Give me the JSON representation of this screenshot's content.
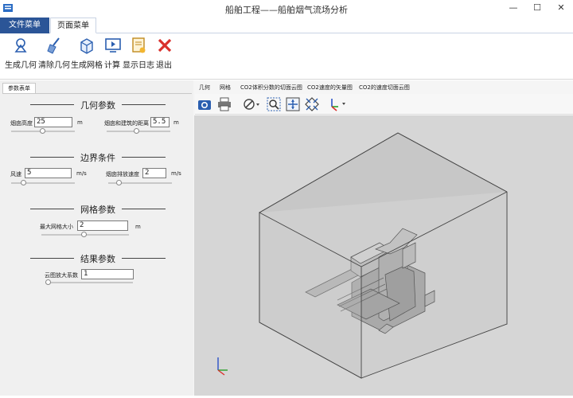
{
  "window": {
    "title": "船舶工程——船舶烟气流场分析",
    "minimize": "—",
    "maximize": "☐",
    "close": "✕"
  },
  "menu_tabs": {
    "file": "文件菜单",
    "page": "页面菜单"
  },
  "ribbon": {
    "gen_geometry": "生成几何",
    "clear_geometry": "清除几何",
    "gen_mesh": "生成网格",
    "compute": "计算",
    "show_log": "显示日志",
    "exit": "退出"
  },
  "params_panel": {
    "tab": "参数表单",
    "geometry": {
      "title": "几何参数",
      "chimney_height_label": "烟囱高度",
      "chimney_height_value": "25",
      "chimney_height_unit": "m",
      "distance_label": "烟囱和建筑的距离",
      "distance_value": "5.5",
      "distance_unit": "m"
    },
    "boundary": {
      "title": "边界条件",
      "wind_label": "风速",
      "wind_value": "5",
      "wind_unit": "m/s",
      "exhaust_label": "烟囱排放速度",
      "exhaust_value": "2",
      "exhaust_unit": "m/s"
    },
    "mesh": {
      "title": "网格参数",
      "max_size_label": "最大网格大小",
      "max_size_value": "2",
      "max_size_unit": "m"
    },
    "result": {
      "title": "结果参数",
      "scale_label": "云图放大系数",
      "scale_value": "1"
    }
  },
  "view_tabs": [
    "几何",
    "网格",
    "CO2体积分数的切面云图",
    "CO2速度的矢量图",
    "CO2的速度切面云图"
  ],
  "icons": {
    "app": "app-icon",
    "gen_geometry": "geometry-icon",
    "clear_geometry": "broom-icon",
    "gen_mesh": "mesh-cube-icon",
    "compute": "compute-icon",
    "show_log": "log-icon",
    "exit": "exit-x-icon"
  },
  "colors": {
    "accent": "#2b5597",
    "exit_red": "#d9302c",
    "axis_x": "#d9302c",
    "axis_y": "#2aa02a",
    "axis_z": "#2b52c8"
  }
}
